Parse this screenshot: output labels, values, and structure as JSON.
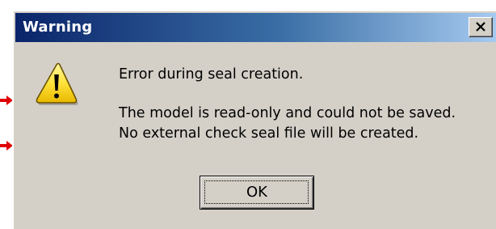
{
  "dialog": {
    "title": "Warning",
    "close_label": "close",
    "icon": "warning-icon",
    "message": {
      "heading": "Error during seal creation.",
      "line1": "The model is read-only and could not be saved.",
      "line2": "No external check seal file will be created."
    },
    "ok_label": "OK"
  },
  "annotations": {
    "arrow_icon": "arrow-right-icon",
    "arrow_color": "#e00000"
  },
  "colors": {
    "title_start": "#0a246a",
    "title_end": "#a6caf0",
    "dialog_bg": "#d4d0c8"
  }
}
